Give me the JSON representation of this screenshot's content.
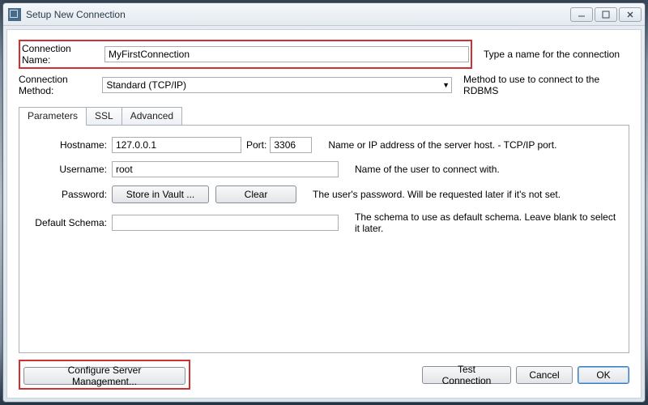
{
  "window": {
    "title": "Setup New Connection"
  },
  "connection": {
    "name_label": "Connection Name:",
    "name_value": "MyFirstConnection",
    "name_help": "Type a name for the connection",
    "method_label": "Connection Method:",
    "method_value": "Standard (TCP/IP)",
    "method_help": "Method to use to connect to the RDBMS"
  },
  "tabs": {
    "parameters": "Parameters",
    "ssl": "SSL",
    "advanced": "Advanced"
  },
  "params": {
    "hostname_label": "Hostname:",
    "hostname_value": "127.0.0.1",
    "port_label": "Port:",
    "port_value": "3306",
    "hostport_help": "Name or IP address of the server host. - TCP/IP port.",
    "username_label": "Username:",
    "username_value": "root",
    "username_help": "Name of the user to connect with.",
    "password_label": "Password:",
    "store_button": "Store in Vault ...",
    "clear_button": "Clear",
    "password_help": "The user's password. Will be requested later if it's not set.",
    "default_schema_label": "Default Schema:",
    "default_schema_value": "",
    "default_schema_help": "The schema to use as default schema. Leave blank to select it later."
  },
  "footer": {
    "configure": "Configure Server Management...",
    "test": "Test Connection",
    "cancel": "Cancel",
    "ok": "OK"
  }
}
